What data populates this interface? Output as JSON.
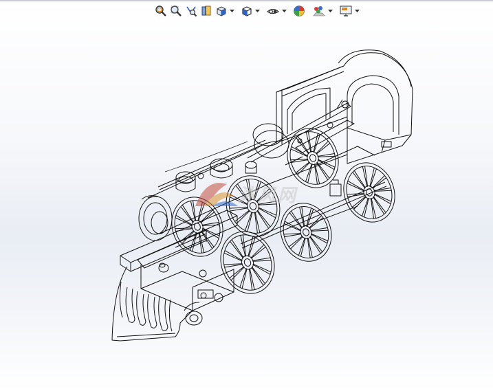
{
  "toolbar": {
    "buttons": [
      {
        "name": "zoom-to-fit",
        "icon": "magnifier-fit-icon"
      },
      {
        "name": "zoom-to-area",
        "icon": "magnifier-area-icon"
      },
      {
        "name": "previous-view",
        "icon": "previous-view-icon"
      },
      {
        "name": "section-view",
        "icon": "section-view-icon"
      },
      {
        "name": "view-orientation",
        "icon": "view-orientation-icon",
        "dropdown": true
      },
      {
        "name": "display-style",
        "icon": "display-style-icon",
        "dropdown": true
      },
      {
        "name": "hide-show-items",
        "icon": "eye-icon",
        "dropdown": true
      },
      {
        "name": "edit-appearance",
        "icon": "color-sphere-icon"
      },
      {
        "name": "apply-scene",
        "icon": "scene-icon",
        "dropdown": true
      },
      {
        "name": "view-settings",
        "icon": "monitor-icon",
        "dropdown": true
      }
    ]
  },
  "colors": {
    "accent_orange": "#d98a20",
    "accent_blue": "#2a64c8",
    "line": "#111111"
  },
  "watermark": {
    "text": "沐风网"
  }
}
